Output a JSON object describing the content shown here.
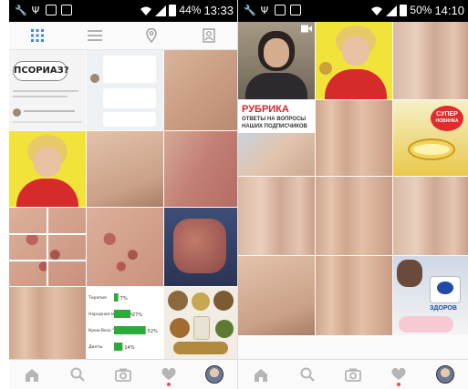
{
  "left_panel": {
    "status_bar": {
      "battery": "44%",
      "time": "13:33"
    },
    "grid": {
      "post_question": "ПСОРИАЗ?",
      "chart": {
        "rows": [
          {
            "label": "Терапия",
            "pct": 7,
            "pct_label": "7%"
          },
          {
            "label": "Народная медицина",
            "pct": 27,
            "pct_label": "27%"
          },
          {
            "label": "Крем-Воск \"Здоров\"",
            "pct": 52,
            "pct_label": "52%"
          },
          {
            "label": "Диеты",
            "pct": 14,
            "pct_label": "14%"
          }
        ]
      }
    }
  },
  "right_panel": {
    "status_bar": {
      "battery": "50%",
      "time": "14:10"
    },
    "grid": {
      "rubric_title": "РУБРИКА",
      "rubric_sub1": "ОТВЕТЫ НА ВОПРОСЫ",
      "rubric_sub2": "НАШИХ ПОДПИСЧИКОВ",
      "badge_line1": "СУПЕР",
      "badge_line2": "НОВИНКА",
      "brand_label": "ЗДОРОВ"
    }
  },
  "colors": {
    "chart_bar": "#2eaa3a",
    "status_bg": "#000000",
    "notification": "#ed4956",
    "rubric_red": "#d9232d"
  },
  "icons": [
    "wrench-icon",
    "usb-icon",
    "image-icon",
    "mail-icon",
    "wifi-icon",
    "signal-icon",
    "grid-icon",
    "list-icon",
    "location-icon",
    "tag-icon",
    "home-icon",
    "search-icon",
    "camera-icon",
    "heart-icon",
    "profile-avatar"
  ]
}
